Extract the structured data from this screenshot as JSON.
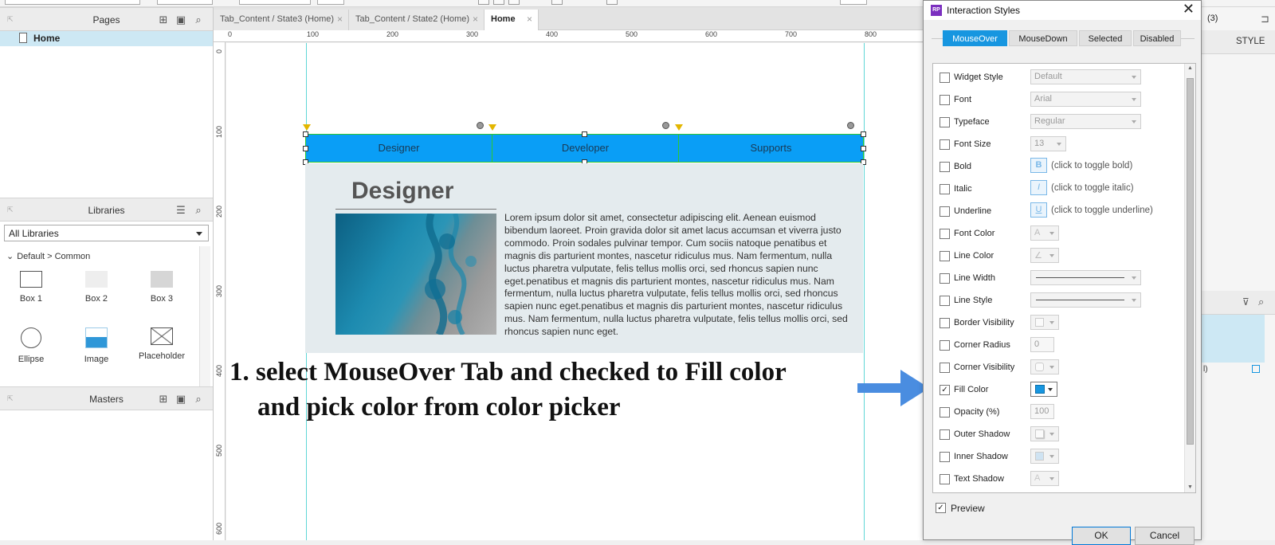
{
  "panels": {
    "pages": {
      "title": "Pages",
      "items": [
        {
          "label": "Home"
        }
      ]
    },
    "libraries": {
      "title": "Libraries",
      "selected": "All Libraries",
      "group": "Default > Common",
      "items": [
        {
          "label": "Box 1"
        },
        {
          "label": "Box 2"
        },
        {
          "label": "Box 3"
        },
        {
          "label": "Ellipse"
        },
        {
          "label": "Image"
        },
        {
          "label": "Placeholder"
        }
      ]
    },
    "masters": {
      "title": "Masters"
    }
  },
  "doc_tabs": [
    {
      "label": "Tab_Content / State3 (Home)",
      "close": "×"
    },
    {
      "label": "Tab_Content / State2 (Home)",
      "close": "×"
    },
    {
      "label": "Home",
      "close": "×"
    }
  ],
  "ruler": {
    "h": [
      "0",
      "100",
      "200",
      "300",
      "400",
      "500",
      "600",
      "700",
      "800"
    ],
    "v": [
      "0",
      "100",
      "200",
      "300",
      "400",
      "500",
      "600"
    ]
  },
  "widget": {
    "tabs": [
      "Designer",
      "Developer",
      "Supports"
    ],
    "heading": "Designer",
    "body": "Lorem ipsum dolor sit amet, consectetur adipiscing elit. Aenean euismod bibendum laoreet. Proin gravida dolor sit amet lacus accumsan et viverra justo commodo. Proin sodales pulvinar tempor. Cum sociis natoque penatibus et magnis dis parturient montes, nascetur ridiculus mus. Nam fermentum, nulla luctus pharetra vulputate, felis tellus mollis orci, sed rhoncus sapien nunc eget.penatibus et magnis dis parturient montes, nascetur ridiculus mus. Nam fermentum, nulla luctus pharetra vulputate, felis tellus mollis orci, sed rhoncus sapien nunc eget.penatibus et magnis dis parturient montes, nascetur ridiculus mus. Nam fermentum, nulla luctus pharetra vulputate, felis tellus mollis orci, sed rhoncus sapien nunc eget.",
    "tab_color": "#0a9ef6"
  },
  "annotation": {
    "line1": "1. select MouseOver Tab and checked to Fill color",
    "line2": "and pick color from color picker"
  },
  "right_panel": {
    "count": "(3)",
    "style_label": "STYLE",
    "small": "l)"
  },
  "dialog": {
    "title": "Interaction Styles",
    "app_icon": "RP",
    "close": "✕",
    "tabs": [
      "MouseOver",
      "MouseDown",
      "Selected",
      "Disabled"
    ],
    "active_tab": "MouseOver",
    "properties": {
      "widget_style": {
        "label": "Widget Style",
        "value": "Default",
        "checked": false
      },
      "font": {
        "label": "Font",
        "value": "Arial",
        "checked": false
      },
      "typeface": {
        "label": "Typeface",
        "value": "Regular",
        "checked": false
      },
      "font_size": {
        "label": "Font Size",
        "value": "13",
        "checked": false
      },
      "bold": {
        "label": "Bold",
        "glyph": "B",
        "hint": "(click to toggle bold)",
        "checked": false
      },
      "italic": {
        "label": "Italic",
        "glyph": "I",
        "hint": "(click to toggle italic)",
        "checked": false
      },
      "underline": {
        "label": "Underline",
        "glyph": "U",
        "hint": "(click to toggle underline)",
        "checked": false
      },
      "font_color": {
        "label": "Font Color",
        "glyph": "A",
        "checked": false
      },
      "line_color": {
        "label": "Line Color",
        "glyph": "∠",
        "checked": false
      },
      "line_width": {
        "label": "Line Width",
        "checked": false
      },
      "line_style": {
        "label": "Line Style",
        "checked": false
      },
      "border_visibility": {
        "label": "Border Visibility",
        "checked": false
      },
      "corner_radius": {
        "label": "Corner Radius",
        "value": "0",
        "checked": false
      },
      "corner_visibility": {
        "label": "Corner Visibility",
        "checked": false
      },
      "fill_color": {
        "label": "Fill Color",
        "checked": true,
        "check_glyph": "✓",
        "color": "#1796e0"
      },
      "opacity": {
        "label": "Opacity (%)",
        "value": "100",
        "checked": false
      },
      "outer_shadow": {
        "label": "Outer Shadow",
        "checked": false
      },
      "inner_shadow": {
        "label": "Inner Shadow",
        "checked": false
      },
      "text_shadow": {
        "label": "Text Shadow",
        "glyph": "A",
        "checked": false
      }
    },
    "preview": {
      "label": "Preview",
      "checked": true,
      "check_glyph": "✓"
    },
    "ok": "OK",
    "cancel": "Cancel"
  },
  "colors": {
    "accent_blue": "#1796e0",
    "selection_green": "#2ec92e",
    "guide_cyan": "#5fd6d6",
    "arrow_blue": "#4a8de0"
  }
}
